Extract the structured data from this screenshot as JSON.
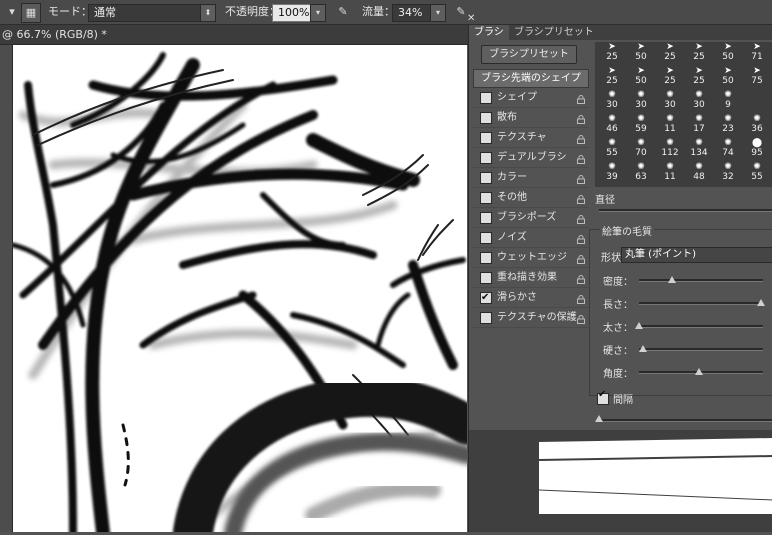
{
  "options_bar": {
    "mode_label": "モード：",
    "mode_value": "通常",
    "opacity_label": "不透明度：",
    "opacity_value": "100%",
    "flow_label": "流量：",
    "flow_value": "34%"
  },
  "document": {
    "tab_title": "@ 66.7% (RGB/8) *"
  },
  "panel": {
    "tabs": [
      "ブラシ",
      "ブラシプリセット"
    ],
    "preset_button": "ブラシプリセット",
    "tip_shape_header": "ブラシ先端のシェイプ",
    "options": [
      {
        "label": "シェイプ",
        "checked": false
      },
      {
        "label": "散布",
        "checked": false
      },
      {
        "label": "テクスチャ",
        "checked": false
      },
      {
        "label": "デュアルブラシ",
        "checked": false
      },
      {
        "label": "カラー",
        "checked": false
      },
      {
        "label": "その他",
        "checked": false
      },
      {
        "label": "ブラシポーズ",
        "checked": false
      },
      {
        "label": "ノイズ",
        "checked": false
      },
      {
        "label": "ウェットエッジ",
        "checked": false
      },
      {
        "label": "重ね描き効果",
        "checked": false
      },
      {
        "label": "滑らかさ",
        "checked": true
      },
      {
        "label": "テクスチャの保護",
        "checked": false
      }
    ],
    "preset_sizes": [
      [
        "25",
        "50",
        "25",
        "25",
        "50",
        "71"
      ],
      [
        "25",
        "50",
        "25",
        "25",
        "50",
        "75"
      ],
      [
        "30",
        "30",
        "30",
        "30",
        "9"
      ],
      [
        "46",
        "59",
        "11",
        "17",
        "23",
        "36"
      ],
      [
        "55",
        "70",
        "112",
        "134",
        "74",
        "95"
      ],
      [
        "39",
        "63",
        "11",
        "48",
        "32",
        "55"
      ]
    ],
    "diameter_label": "直径",
    "bristle_label": "絵筆の毛質",
    "shape_label": "形状：",
    "shape_value": "丸筆 (ポイント)",
    "sliders": [
      {
        "label": "密度：",
        "value": 0.27
      },
      {
        "label": "長さ：",
        "value": 0.98
      },
      {
        "label": "太さ：",
        "value": 0.0
      },
      {
        "label": "硬さ：",
        "value": 0.03
      },
      {
        "label": "角度：",
        "value": 0.48
      }
    ],
    "spacing_label": "間隔",
    "spacing_checked": true
  }
}
